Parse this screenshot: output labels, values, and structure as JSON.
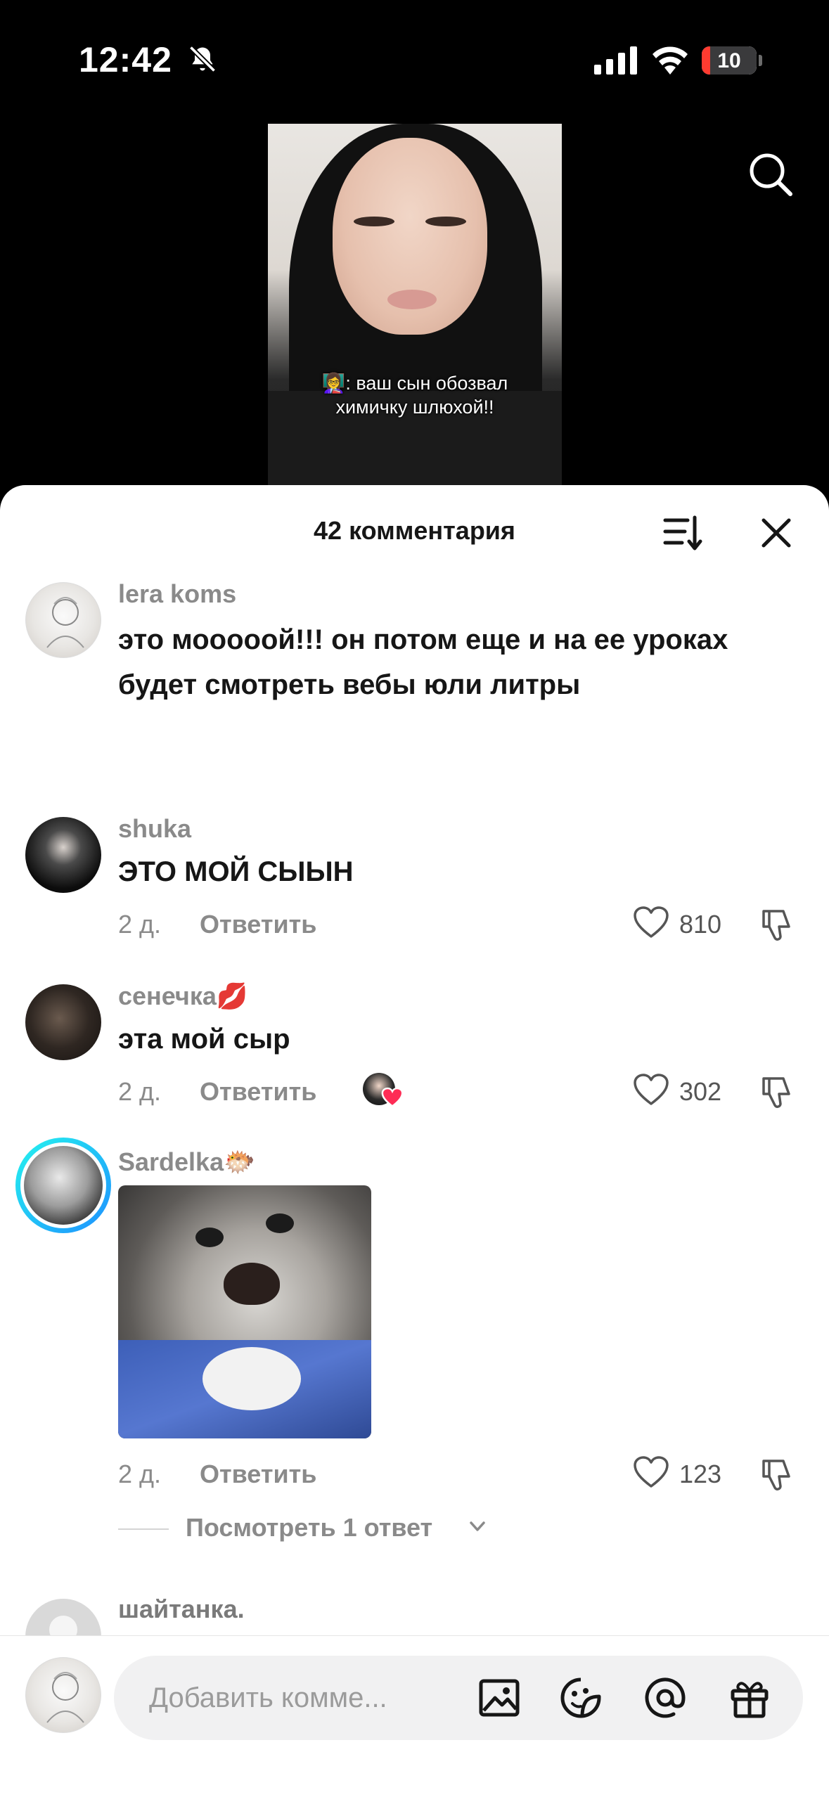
{
  "status_bar": {
    "time": "12:42",
    "battery": "10",
    "battery_level": 0.1
  },
  "video": {
    "caption": "👩‍🏫: ваш сын обозвал химичку шлюхой!!"
  },
  "sheet": {
    "title": "42 комментария"
  },
  "comments": [
    {
      "username": "lera koms",
      "text": "это мооооой!!! он потом еще и на ее уроках будет смотреть вебы юли литры"
    },
    {
      "username": "shuka",
      "text": "ЭТО МОЙ СЫЫН",
      "date": "2 д.",
      "reply_label": "Ответить",
      "likes": "810"
    },
    {
      "username": "сенечка💋",
      "text": "эта мой сыр",
      "date": "2 д.",
      "reply_label": "Ответить",
      "likes": "302"
    },
    {
      "username": "Sardelka🐡",
      "date": "2 д.",
      "reply_label": "Ответить",
      "likes": "123",
      "view_replies": "Посмотреть 1 ответ"
    },
    {
      "username": "шайтанка."
    }
  ],
  "input": {
    "placeholder": "Добавить комме..."
  },
  "icons": {
    "search": "search-icon",
    "sort": "sort-icon",
    "close": "close-icon",
    "heart": "heart-icon",
    "dislike": "dislike-icon",
    "image": "image-icon",
    "sticker": "sticker-icon",
    "mention": "mention-icon",
    "gift": "gift-icon"
  },
  "colors": {
    "story_ring_start": "#25f4ee",
    "story_ring_end": "#1e90ff",
    "liked_heart": "#fe2c55",
    "battery_low": "#ff3b30"
  }
}
